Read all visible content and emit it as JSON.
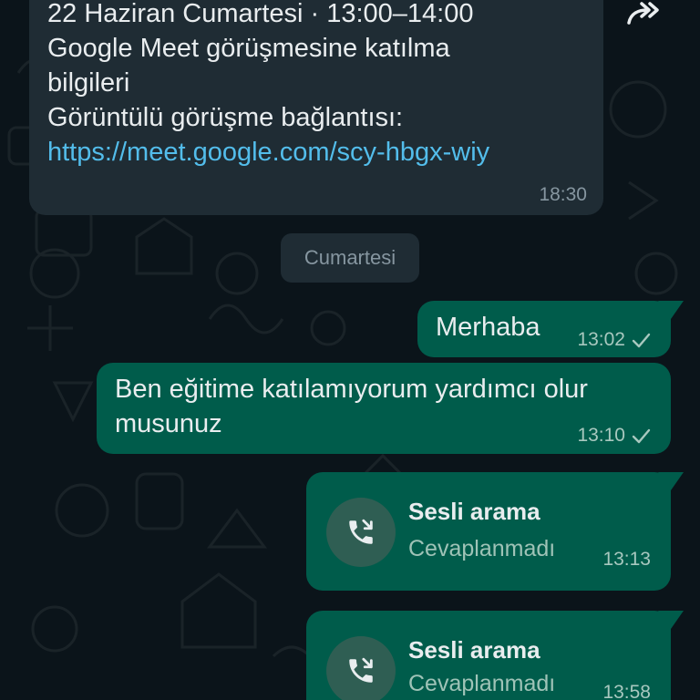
{
  "incoming": {
    "lines": [
      "22 Haziran Cumartesi · 13:00–14:00",
      "Google Meet görüşmesine katılma",
      "bilgileri",
      "Görüntülü görüşme bağlantısı:"
    ],
    "link": "https://meet.google.com/scy-hbgx-wiy",
    "time": "18:30",
    "forward_icon": "forward-icon"
  },
  "date_chip": "Cumartesi",
  "outgoing": [
    {
      "text": "Merhaba",
      "time": "13:02"
    },
    {
      "text_lines": [
        "Ben eğitime katılamıyorum yardımcı olur",
        "musunuz"
      ],
      "time": "13:10"
    }
  ],
  "calls": [
    {
      "title": "Sesli arama",
      "status": "Cevaplanmadı",
      "time": "13:13",
      "icon": "missed-outgoing-call-icon"
    },
    {
      "title": "Sesli arama",
      "status": "Cevaplanmadı",
      "time": "13:58",
      "icon": "missed-outgoing-call-icon"
    }
  ],
  "colors": {
    "background": "#0b141a",
    "incoming_bubble": "#1f2c34",
    "outgoing_bubble": "#005c4b",
    "link": "#53bdeb",
    "timestamp": "#8696a0"
  }
}
